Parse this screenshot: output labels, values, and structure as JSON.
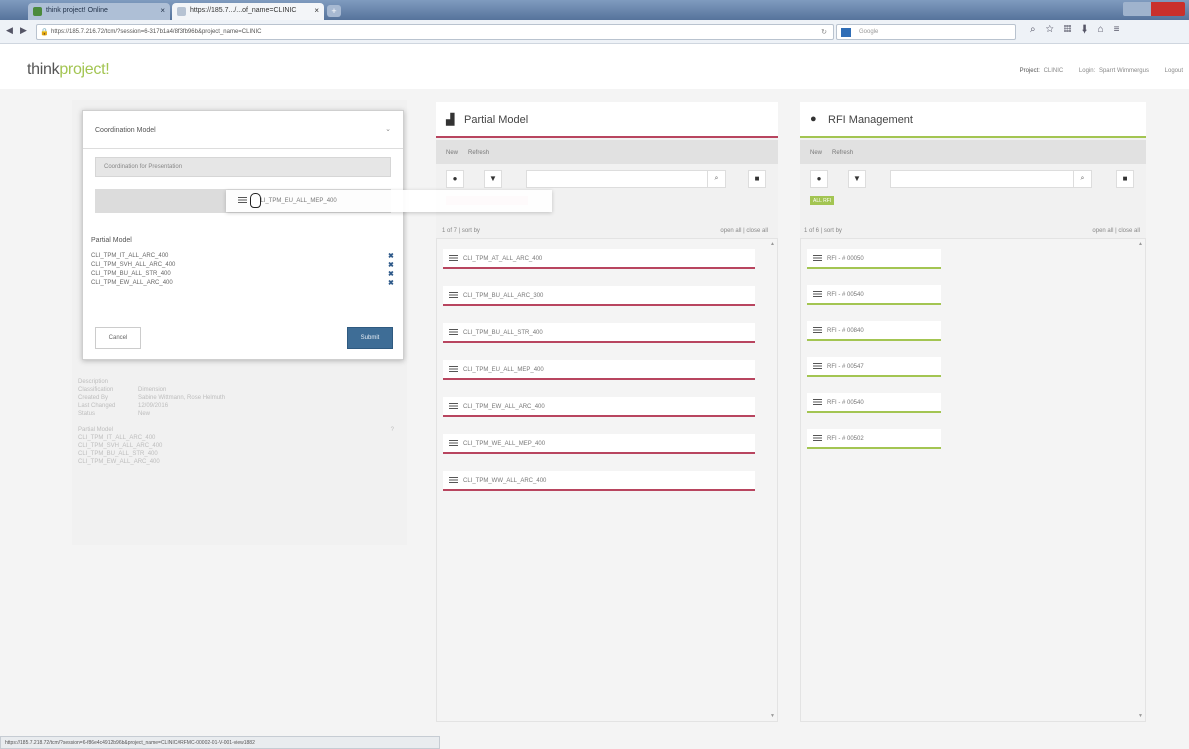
{
  "browser": {
    "tabs": [
      {
        "label": "think project! Online"
      },
      {
        "label": "https://185.7.../...of_name=CLINIC"
      }
    ],
    "new_tab_label": "+",
    "url": "https://185.7.216.72/tcm/?session=6-317b1a4/8f3fb96b&project_name=CLINIC",
    "search_placeholder": "Google",
    "status_url": "https://185.7.218.72/tcm/?session=6-f86e4c4912b96b&project_name=CLINIC#RFMC-00002-01-V-001-view1882"
  },
  "header": {
    "logo_think": "think",
    "logo_project": "project!",
    "project_label": "Project:",
    "project_value": "CLINIC",
    "login_label": "Login:",
    "login_value": "Sparrt Wimmergus",
    "logout_label": "Logout"
  },
  "background_details": {
    "section": "Description",
    "rows": [
      {
        "k": "Classification",
        "v": "Dimension"
      },
      {
        "k": "Created By",
        "v": "Sabine Wittmann, Rose Helmuth"
      },
      {
        "k": "Last Changed",
        "v": "12/09/2016"
      },
      {
        "k": "Status",
        "v": "New"
      }
    ],
    "models_title": "Partial Model",
    "models_marker": "?",
    "models": [
      "CLI_TPM_IT_ALL_ARC_400",
      "CLI_TPM_SVH_ALL_ARC_400",
      "CLI_TPM_BU_ALL_STR_400",
      "CLI_TPM_EW_ALL_ARC_400"
    ]
  },
  "dialog": {
    "selected": "Coordination Model",
    "field1": "Coordination for Presentation",
    "section_title": "Partial Model",
    "models": [
      "CLI_TPM_IT_ALL_ARC_400",
      "CLI_TPM_SVH_ALL_ARC_400",
      "CLI_TPM_BU_ALL_STR_400",
      "CLI_TPM_EW_ALL_ARC_400"
    ],
    "remove_glyph": "✖",
    "cancel": "Cancel",
    "submit": "Submit"
  },
  "drag": {
    "label": "CLI_TPM_EU_ALL_MEP_400"
  },
  "partial_model": {
    "title": "Partial Model",
    "actions": [
      "New",
      "Refresh"
    ],
    "meta_left": "1 of 7 | sort by",
    "meta_right": "open all | close all",
    "items": [
      "CLI_TPM_AT_ALL_ARC_400",
      "CLI_TPM_BU_ALL_ARC_300",
      "CLI_TPM_BU_ALL_STR_400",
      "CLI_TPM_EU_ALL_MEP_400",
      "CLI_TPM_EW_ALL_ARC_400",
      "CLI_TPM_WE_ALL_MEP_400",
      "CLI_TPM_WW_ALL_ARC_400"
    ]
  },
  "rfi": {
    "title": "RFI Management",
    "actions": [
      "New",
      "Refresh"
    ],
    "filter_tag": "ALL RFI",
    "meta_left": "1 of 6 | sort by",
    "meta_right": "open all | close all",
    "items": [
      "RFI - # 00050",
      "RFI - # 00540",
      "RFI - # 00840",
      "RFI - # 00547",
      "RFI - # 00540",
      "RFI - # 00502"
    ]
  },
  "colors": {
    "partial_accent": "#b8455f",
    "rfi_accent": "#a3c552",
    "submit": "#3e6d96"
  }
}
